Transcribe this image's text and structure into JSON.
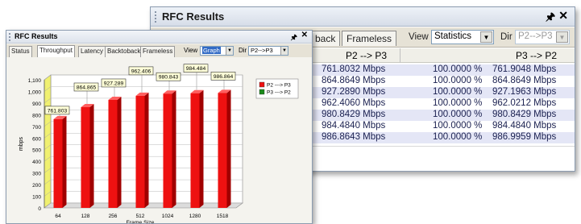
{
  "back_window": {
    "title": "RFC Results",
    "pin_glyph": "p",
    "close_glyph": "×",
    "tabs": [
      "back",
      "Frameless"
    ],
    "view_label": "View",
    "view_value": "Statistics",
    "dir_label": "Dir",
    "dir_value": "P2-->P3",
    "columns": [
      "P2 --> P3",
      "P3 --> P2"
    ],
    "rows": [
      {
        "p2p3": "761.8032 Mbps",
        "pct": "100.0000 %",
        "p3p2": "761.9048 Mbps"
      },
      {
        "p2p3": "864.8649 Mbps",
        "pct": "100.0000 %",
        "p3p2": "864.8649 Mbps"
      },
      {
        "p2p3": "927.2890 Mbps",
        "pct": "100.0000 %",
        "p3p2": "927.1963 Mbps"
      },
      {
        "p2p3": "962.4060 Mbps",
        "pct": "100.0000 %",
        "p3p2": "962.0212 Mbps"
      },
      {
        "p2p3": "980.8429 Mbps",
        "pct": "100.0000 %",
        "p3p2": "980.8429 Mbps"
      },
      {
        "p2p3": "984.4840 Mbps",
        "pct": "100.0000 %",
        "p3p2": "984.4840 Mbps"
      },
      {
        "p2p3": "986.8643 Mbps",
        "pct": "100.0000 %",
        "p3p2": "986.9959 Mbps"
      }
    ]
  },
  "front_window": {
    "title": "RFC Results",
    "tabs": [
      "Status",
      "Throughput",
      "Latency",
      "Backtoback",
      "Frameless"
    ],
    "active_tab": "Throughput",
    "view_label": "View",
    "view_value": "Graph",
    "dir_label": "Dir",
    "dir_value": "P2-->P3"
  },
  "chart_data": {
    "type": "bar",
    "categories": [
      "64",
      "128",
      "256",
      "512",
      "1024",
      "1280",
      "1518"
    ],
    "series": [
      {
        "name": "P2 ---> P3",
        "color": "#ee1111",
        "values": [
          761.803,
          864.865,
          927.289,
          962.406,
          980.843,
          984.484,
          986.864
        ]
      },
      {
        "name": "P3 ---> P2",
        "color": "#1a8a1a",
        "values": []
      }
    ],
    "data_labels": [
      "761.803",
      "864.865",
      "927.289",
      "962.406",
      "980.843",
      "984.484",
      "986.864"
    ],
    "xlabel": "Frame Size",
    "ylabel": "mbps",
    "ylim": [
      0,
      1100
    ],
    "yticks": [
      0,
      100,
      200,
      300,
      400,
      500,
      600,
      700,
      800,
      900,
      "1,000",
      "1,100"
    ],
    "grid": true,
    "legend_position": "top-right"
  },
  "colors": {
    "bar": "#ee1111",
    "row_alt": "#e4e6f6",
    "label_box": "#ffffd8"
  }
}
